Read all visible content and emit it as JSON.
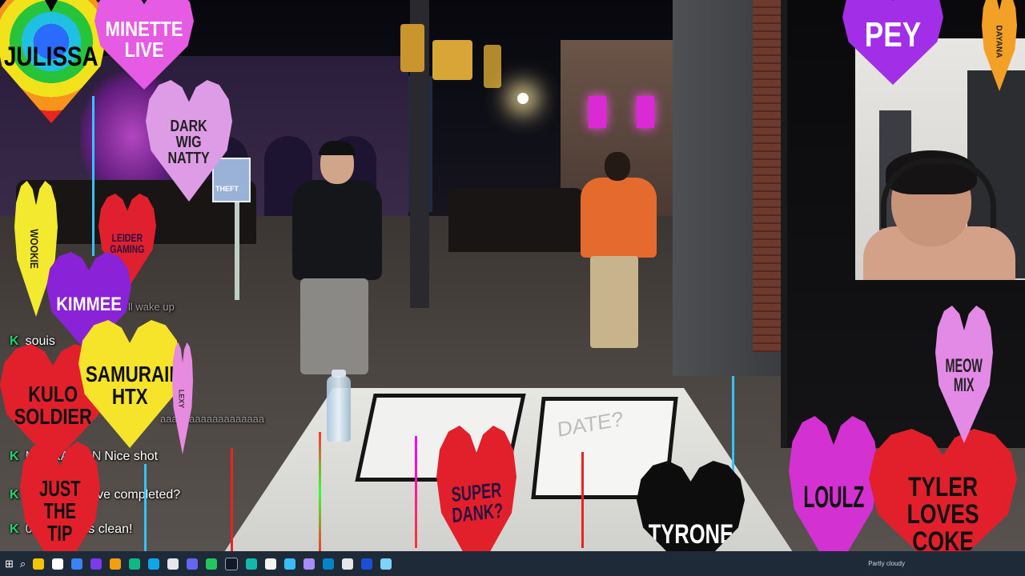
{
  "stream": {
    "webcam_label": "streamer webcam"
  },
  "chat": {
    "ghost_lines": [
      "ll wake up",
      "aaaaaaaaaaaaaaaaaa"
    ],
    "messages": [
      {
        "user": "",
        "text": "souis"
      },
      {
        "user": "MAYKA_FAN",
        "text": "Nice shot"
      },
      {
        "user": "56",
        "text": "Objective completed?"
      },
      {
        "user": "00",
        "text": "That was clean!"
      }
    ]
  },
  "scene": {
    "street_sign": "THEFT",
    "board_text": "DATE?"
  },
  "hearts": [
    {
      "name": "julissa",
      "label": "JULISSA",
      "color": "rainbow",
      "text_color": "#000000"
    },
    {
      "name": "minette-live",
      "label": "MINETTE\nLIVE",
      "color": "#e65be3",
      "text_color": "#ffffff"
    },
    {
      "name": "dark-wig-natty",
      "label": "DARK\nWIG\nNATTY",
      "color": "#de9be6",
      "text_color": "#222222"
    },
    {
      "name": "wookie",
      "label": "WOOKIE",
      "color": "#f3ea2f",
      "text_color": "#222222"
    },
    {
      "name": "leider-gaming",
      "label": "LEIDER\nGAMING",
      "color": "#e0202e",
      "text_color": "#2a1040"
    },
    {
      "name": "kimmee",
      "label": "KIMMEE",
      "color": "#8a22d8",
      "text_color": "#ffffff"
    },
    {
      "name": "kulo-soldier",
      "label": "KULO\nSOLDIER",
      "color": "#e2202c",
      "text_color": "#111111"
    },
    {
      "name": "samuraii-htx",
      "label": "SAMURAII\nHTX",
      "color": "#f6e42a",
      "text_color": "#111111"
    },
    {
      "name": "tiny-pink",
      "label": "LEXY",
      "color": "#e68be0",
      "text_color": "#333333"
    },
    {
      "name": "just-the-tip",
      "label": "JUST\nTHE\nTIP",
      "color": "#e2202c",
      "text_color": "#111111"
    },
    {
      "name": "super-dank",
      "label": "SUPER\nDANK?",
      "color": "#e2202c",
      "text_color": "#2a1040"
    },
    {
      "name": "tyrone",
      "label": "TYRONE",
      "color": "#0d0d0d",
      "text_color": "#ffffff"
    },
    {
      "name": "loulz",
      "label": "LOULZ",
      "color": "#d431d3",
      "text_color": "#111111"
    },
    {
      "name": "tyler-loves-coke",
      "label": "TYLER\nLOVES\nCOKE",
      "color": "#e2202c",
      "text_color": "#111111"
    },
    {
      "name": "meow-mix",
      "label": "MEOW\nMIX",
      "color": "#e28ae6",
      "text_color": "#222222"
    },
    {
      "name": "pey",
      "label": "PEY",
      "color": "#a22ee8",
      "text_color": "#ffffff"
    },
    {
      "name": "dayana",
      "label": "DAYANA",
      "color": "#f3a126",
      "text_color": "#222222"
    }
  ],
  "taskbar": {
    "tray_text": "Partly cloudy"
  },
  "colors": {
    "chat_k": "#22d36b",
    "taskbar": "#1f2a38"
  }
}
